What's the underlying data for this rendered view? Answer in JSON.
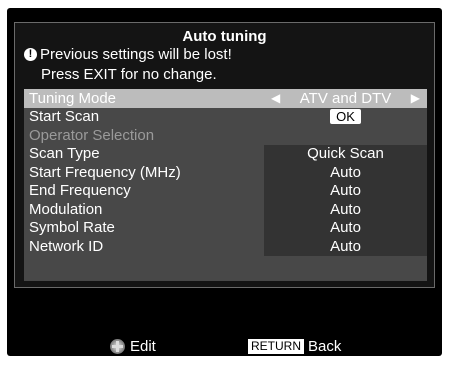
{
  "dialog": {
    "title": "Auto tuning",
    "warning": "Previous settings will be lost!",
    "note": "Press EXIT for no change."
  },
  "rows": [
    {
      "label": "Tuning Mode",
      "value": "ATV and DTV"
    },
    {
      "label": "Start Scan",
      "value": "OK"
    },
    {
      "label": "Operator Selection",
      "value": ""
    },
    {
      "label": "Scan Type",
      "value": "Quick Scan"
    },
    {
      "label": "Start Frequency (MHz)",
      "value": "Auto"
    },
    {
      "label": "End Frequency",
      "value": "Auto"
    },
    {
      "label": "Modulation",
      "value": "Auto"
    },
    {
      "label": "Symbol Rate",
      "value": "Auto"
    },
    {
      "label": "Network ID",
      "value": "Auto"
    }
  ],
  "footer": {
    "edit_label": "Edit",
    "return_key": "RETURN",
    "back_label": "Back"
  },
  "colors": {
    "list_bg": "#484848",
    "selected_row_bg": "#bcbcbc",
    "value_column_bg": "#333333"
  },
  "icons": {
    "warning": "exclamation-circle-icon",
    "left": "triangle-left-icon",
    "right": "triangle-right-icon",
    "edit": "dpad-icon"
  }
}
